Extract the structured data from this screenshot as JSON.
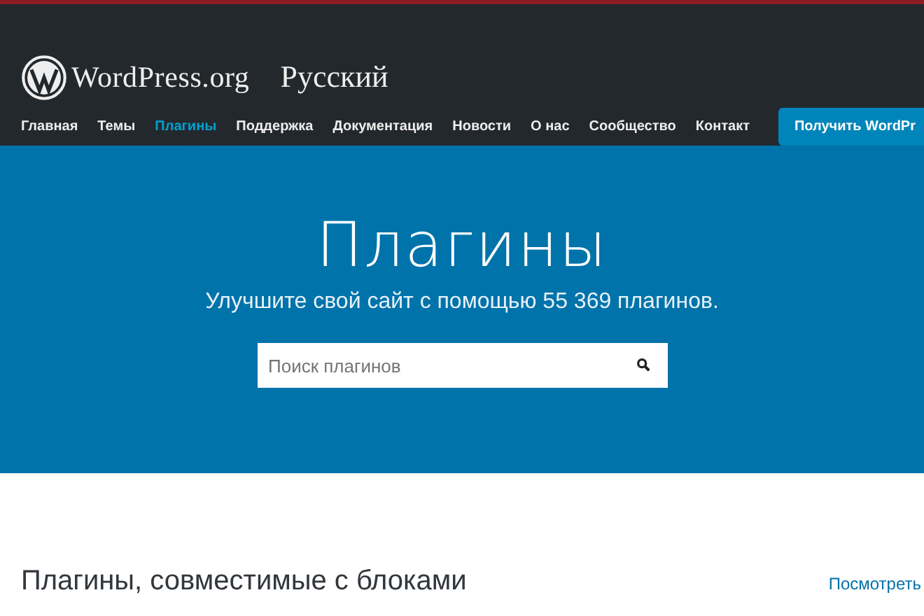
{
  "header": {
    "logo": "WordPress.org",
    "locale": "Русский",
    "nav": [
      {
        "label": "Главная",
        "selected": false
      },
      {
        "label": "Темы",
        "selected": false
      },
      {
        "label": "Плагины",
        "selected": true
      },
      {
        "label": "Поддержка",
        "selected": false
      },
      {
        "label": "Документация",
        "selected": false
      },
      {
        "label": "Новости",
        "selected": false
      },
      {
        "label": "О нас",
        "selected": false
      },
      {
        "label": "Сообщество",
        "selected": false
      },
      {
        "label": "Контакт",
        "selected": false
      }
    ],
    "get_button": "Получить WordPr"
  },
  "hero": {
    "title": "Плагины",
    "subtitle": "Улучшите свой сайт с помощью 55 369 плагинов.",
    "search": {
      "placeholder": "Поиск плагинов"
    }
  },
  "section": {
    "heading": "Плагины, совместимые с блоками",
    "link": "Посмотреть"
  }
}
